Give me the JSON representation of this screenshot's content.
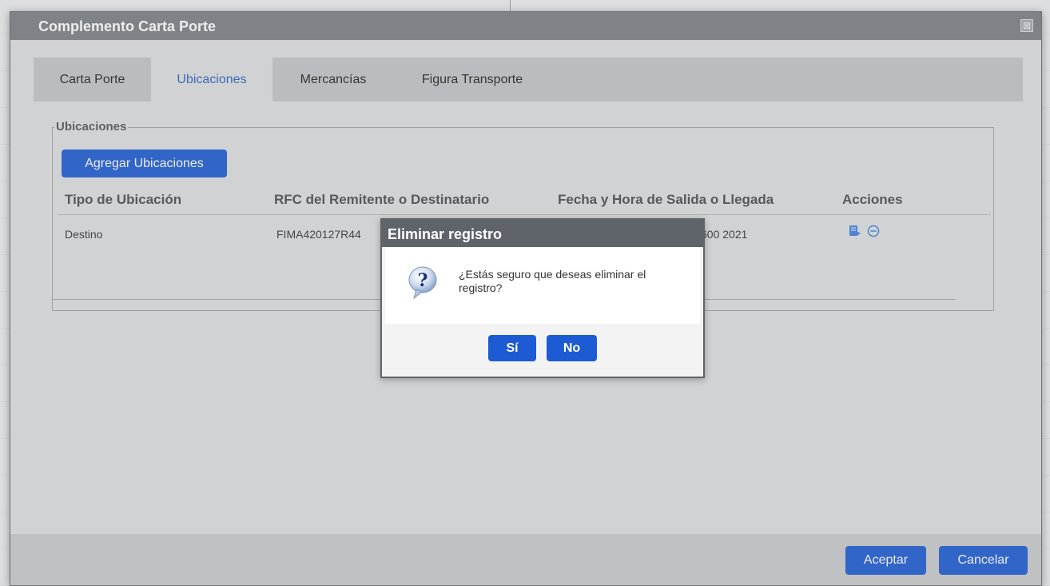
{
  "window": {
    "title": "Complemento Carta Porte",
    "close_symbol": "⊠"
  },
  "tabs": [
    {
      "label": "Carta Porte",
      "active": false
    },
    {
      "label": "Ubicaciones",
      "active": true
    },
    {
      "label": "Mercancías",
      "active": false
    },
    {
      "label": "Figura Transporte",
      "active": false
    }
  ],
  "section": {
    "legend": "Ubicaciones",
    "add_button": "Agregar Ubicaciones",
    "columns": [
      "Tipo de Ubicación",
      "RFC del Remitente o Destinatario",
      "Fecha y Hora de Salida o Llegada",
      "Acciones"
    ],
    "rows": [
      {
        "tipo": "Destino",
        "rfc": "FIMA420127R44",
        "fecha_visible": "600 2021",
        "actions": [
          "edit-icon",
          "remove-icon"
        ]
      }
    ]
  },
  "footer": {
    "accept": "Aceptar",
    "cancel": "Cancelar"
  },
  "modal": {
    "title": "Eliminar registro",
    "icon": "question-icon",
    "message": "¿Estás seguro que deseas eliminar el registro?",
    "yes": "Sí",
    "no": "No"
  },
  "colors": {
    "primary_button": "#1d5bd4",
    "active_tab_text": "#2b5fbf",
    "title_bar": "#7b7f85",
    "modal_title_bar": "#5f636a"
  }
}
